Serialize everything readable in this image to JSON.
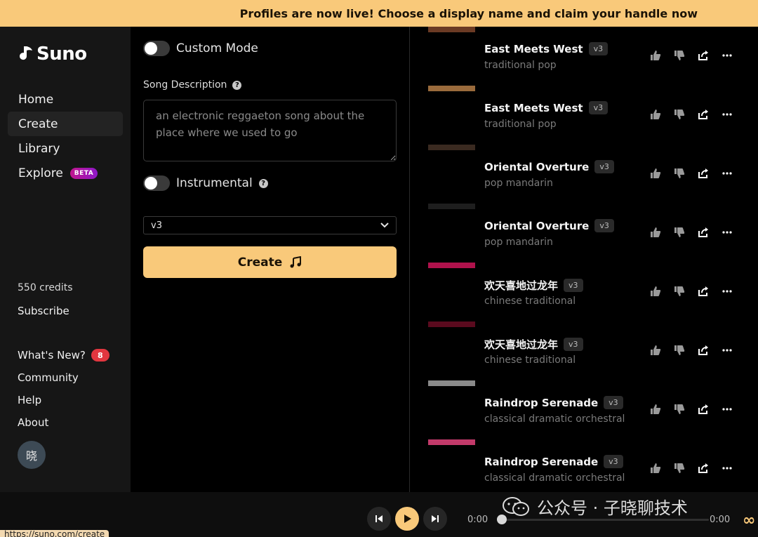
{
  "banner": {
    "text": "Profiles are now live! Choose a display name and claim your handle now"
  },
  "brand": {
    "name": "Suno",
    "accent": "#f9c97a"
  },
  "nav": {
    "home": "Home",
    "create": "Create",
    "library": "Library",
    "explore": "Explore",
    "explore_badge": "BETA"
  },
  "account": {
    "credits": "550 credits",
    "subscribe": "Subscribe",
    "whats_new": "What's New?",
    "whats_new_count": "8",
    "community": "Community",
    "help": "Help",
    "about": "About",
    "avatar_initial": "晓"
  },
  "form": {
    "custom_mode_label": "Custom Mode",
    "song_description_label": "Song Description",
    "song_description_placeholder": "an electronic reggaeton song about the place where we used to go",
    "instrumental_label": "Instrumental",
    "model_selected": "v3",
    "create_label": "Create"
  },
  "songs": [
    {
      "title": "East Meets West",
      "version": "v3",
      "genre": "traditional pop",
      "thumb_color": "#6b3a24"
    },
    {
      "title": "East Meets West",
      "version": "v3",
      "genre": "traditional pop",
      "thumb_color": "#9a6b3c"
    },
    {
      "title": "Oriental Overture",
      "version": "v3",
      "genre": "pop mandarin",
      "thumb_color": "#3a2a20"
    },
    {
      "title": "Oriental Overture",
      "version": "v3",
      "genre": "pop mandarin",
      "thumb_color": "#1e1e1e"
    },
    {
      "title": "欢天喜地过龙年",
      "version": "v3",
      "genre": "chinese traditional",
      "thumb_color": "#b0124c"
    },
    {
      "title": "欢天喜地过龙年",
      "version": "v3",
      "genre": "chinese traditional",
      "thumb_color": "#5a0a1e"
    },
    {
      "title": "Raindrop Serenade",
      "version": "v3",
      "genre": "classical dramatic orchestral",
      "thumb_color": "#8a8a8a"
    },
    {
      "title": "Raindrop Serenade",
      "version": "v3",
      "genre": "classical dramatic orchestral",
      "thumb_color": "#c23a6a"
    }
  ],
  "player": {
    "time_current": "0:00",
    "time_total": "0:00",
    "progress": 0
  },
  "watermark": {
    "text": "公众号 · 子晓聊技术"
  },
  "status_url": "https://suno.com/create"
}
